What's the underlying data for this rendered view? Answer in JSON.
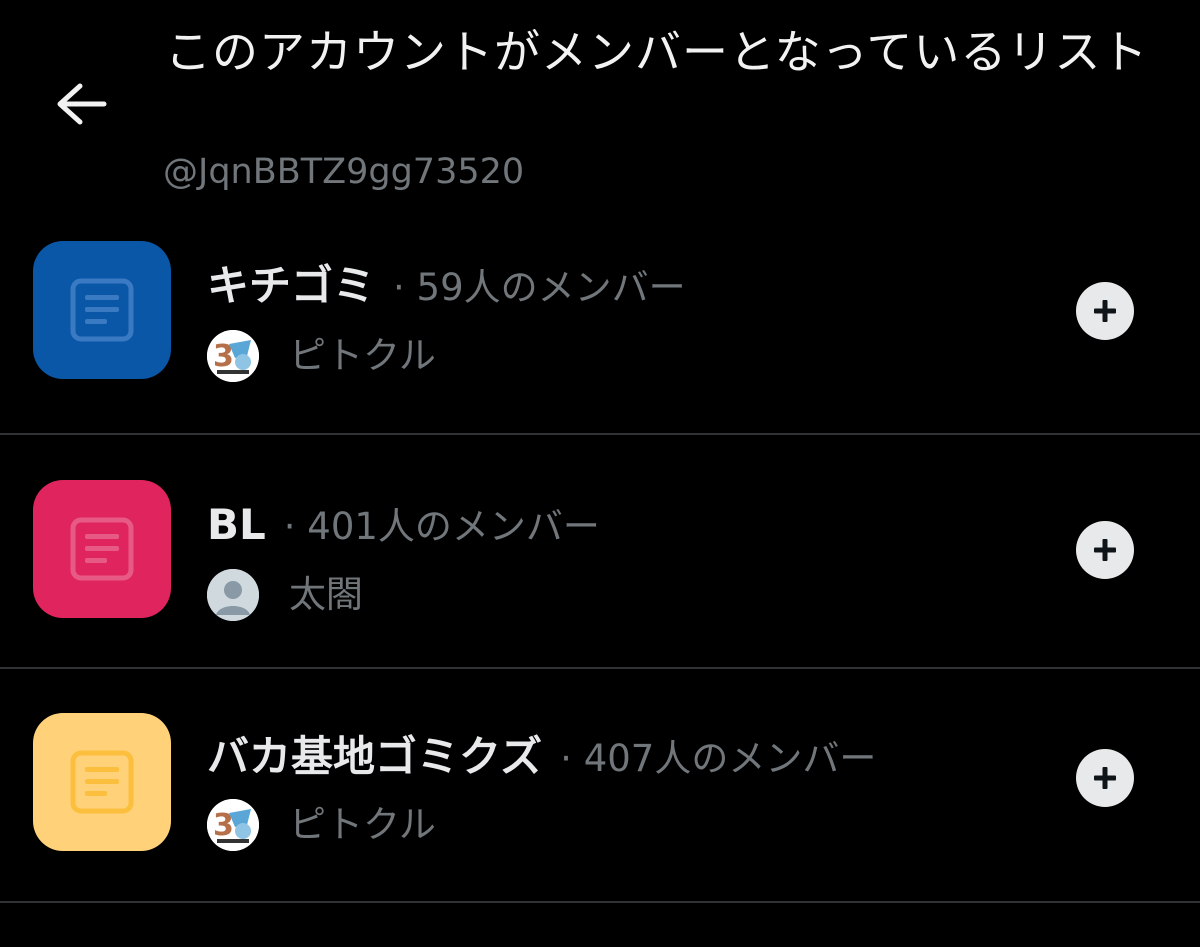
{
  "header": {
    "title": "このアカウントがメンバーとなっているリスト",
    "handle": "@JqnBBTZ9gg73520"
  },
  "lists": [
    {
      "name": "キチゴミ",
      "meta": "· 59人のメンバー",
      "owner": "ピトクル",
      "icon_color": "#0a57a8",
      "icon_fg": "#3a7ac2",
      "avatar_type": "illustration"
    },
    {
      "name": "BL",
      "meta": "· 401人のメンバー",
      "owner": "太閤",
      "icon_color": "#e0245e",
      "icon_fg": "#e85a86",
      "avatar_type": "default"
    },
    {
      "name": "バカ基地ゴミクズ",
      "meta": "· 407人のメンバー",
      "owner": "ピトクル",
      "icon_color": "#ffd27a",
      "icon_fg": "#fcbf3d",
      "avatar_type": "illustration"
    }
  ],
  "icons": {
    "back": "arrow-left-icon",
    "list": "document-list-icon",
    "add": "plus-icon"
  },
  "colors": {
    "background": "#000000",
    "text_primary": "#e7e9ea",
    "text_secondary": "#71767b",
    "divider": "#2f3336"
  }
}
